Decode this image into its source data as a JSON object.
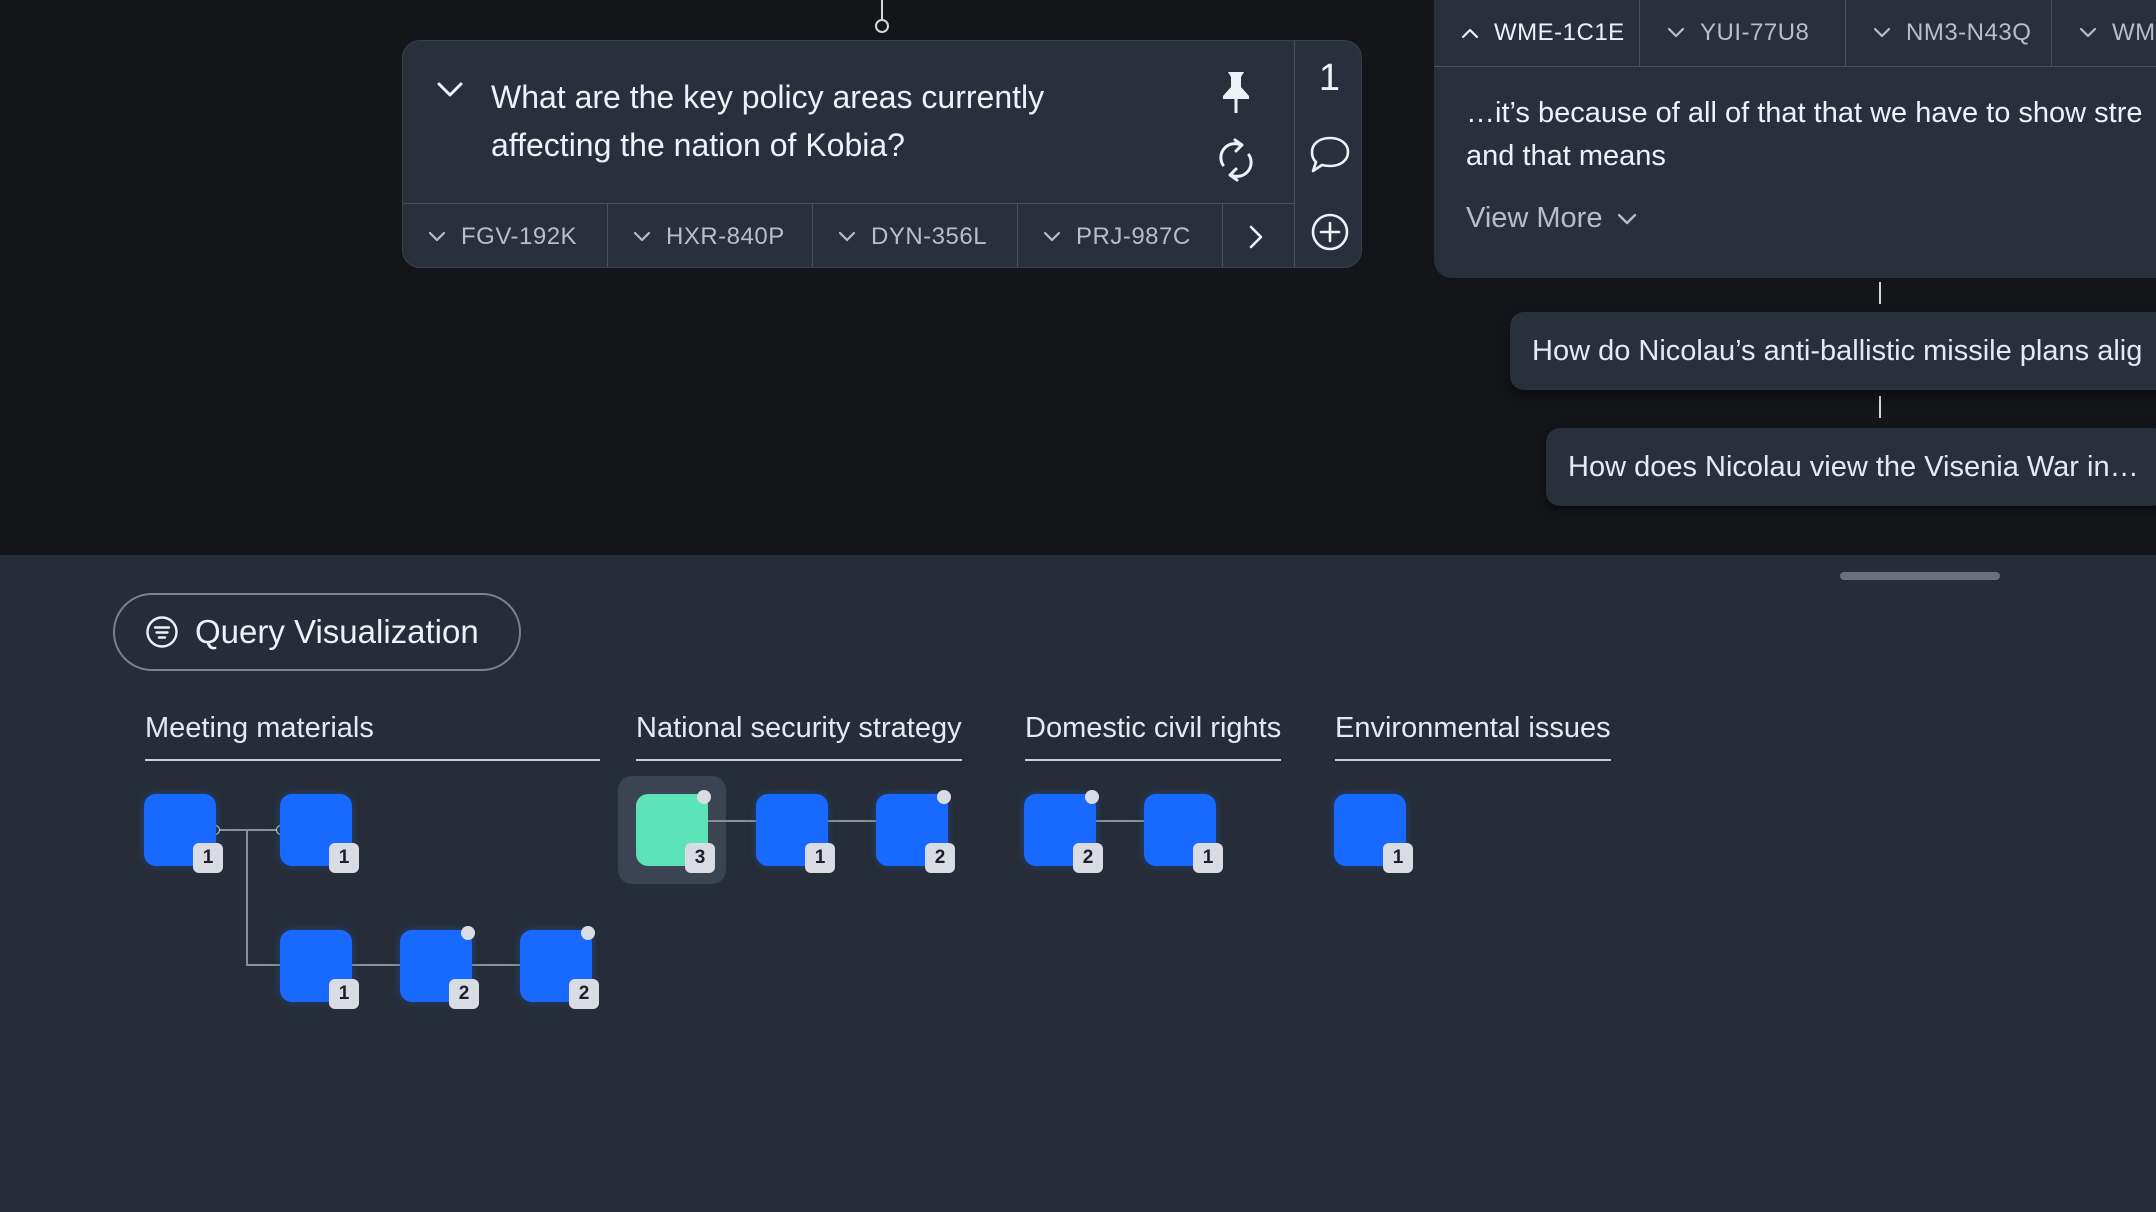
{
  "query": {
    "text": "What are the key policy areas currently affecting the nation of Kobia?",
    "count": "1",
    "tabs": [
      "FGV-192K",
      "HXR-840P",
      "DYN-356L",
      "PRJ-987C"
    ]
  },
  "answer": {
    "tabs": [
      "WME-1C1E",
      "YUI-77U8",
      "NM3-N43Q",
      "WM"
    ],
    "active_tab": "WME-1C1E",
    "text_line1": "…it’s because of all of that that we have to show stre",
    "text_line2": "and that means",
    "view_more": "View More"
  },
  "followups": [
    "How do Nicolau’s anti-ballistic missile plans alig",
    "How does Nicolau view the Visenia War in…"
  ],
  "query_visualization": {
    "button_label": "Query Visualization",
    "categories": [
      "Meeting materials",
      "National security strategy",
      "Domestic civil rights",
      "Environmental issues"
    ],
    "nodes": {
      "meeting": [
        "1",
        "1",
        "1",
        "2",
        "2"
      ],
      "security": [
        "3",
        "1",
        "2"
      ],
      "civil": [
        "2",
        "1"
      ],
      "environment": [
        "1"
      ]
    }
  },
  "colors": {
    "node": "#1769ff",
    "node_selected": "#5de3b8",
    "panel": "#2a303b",
    "background_top": "#141518",
    "background_bottom": "#262d38"
  },
  "icons": [
    "chevron-down-icon",
    "pin-icon",
    "refresh-icon",
    "comment-icon",
    "add-icon",
    "chevron-right-icon",
    "chevron-up-icon",
    "filter-list-icon"
  ]
}
